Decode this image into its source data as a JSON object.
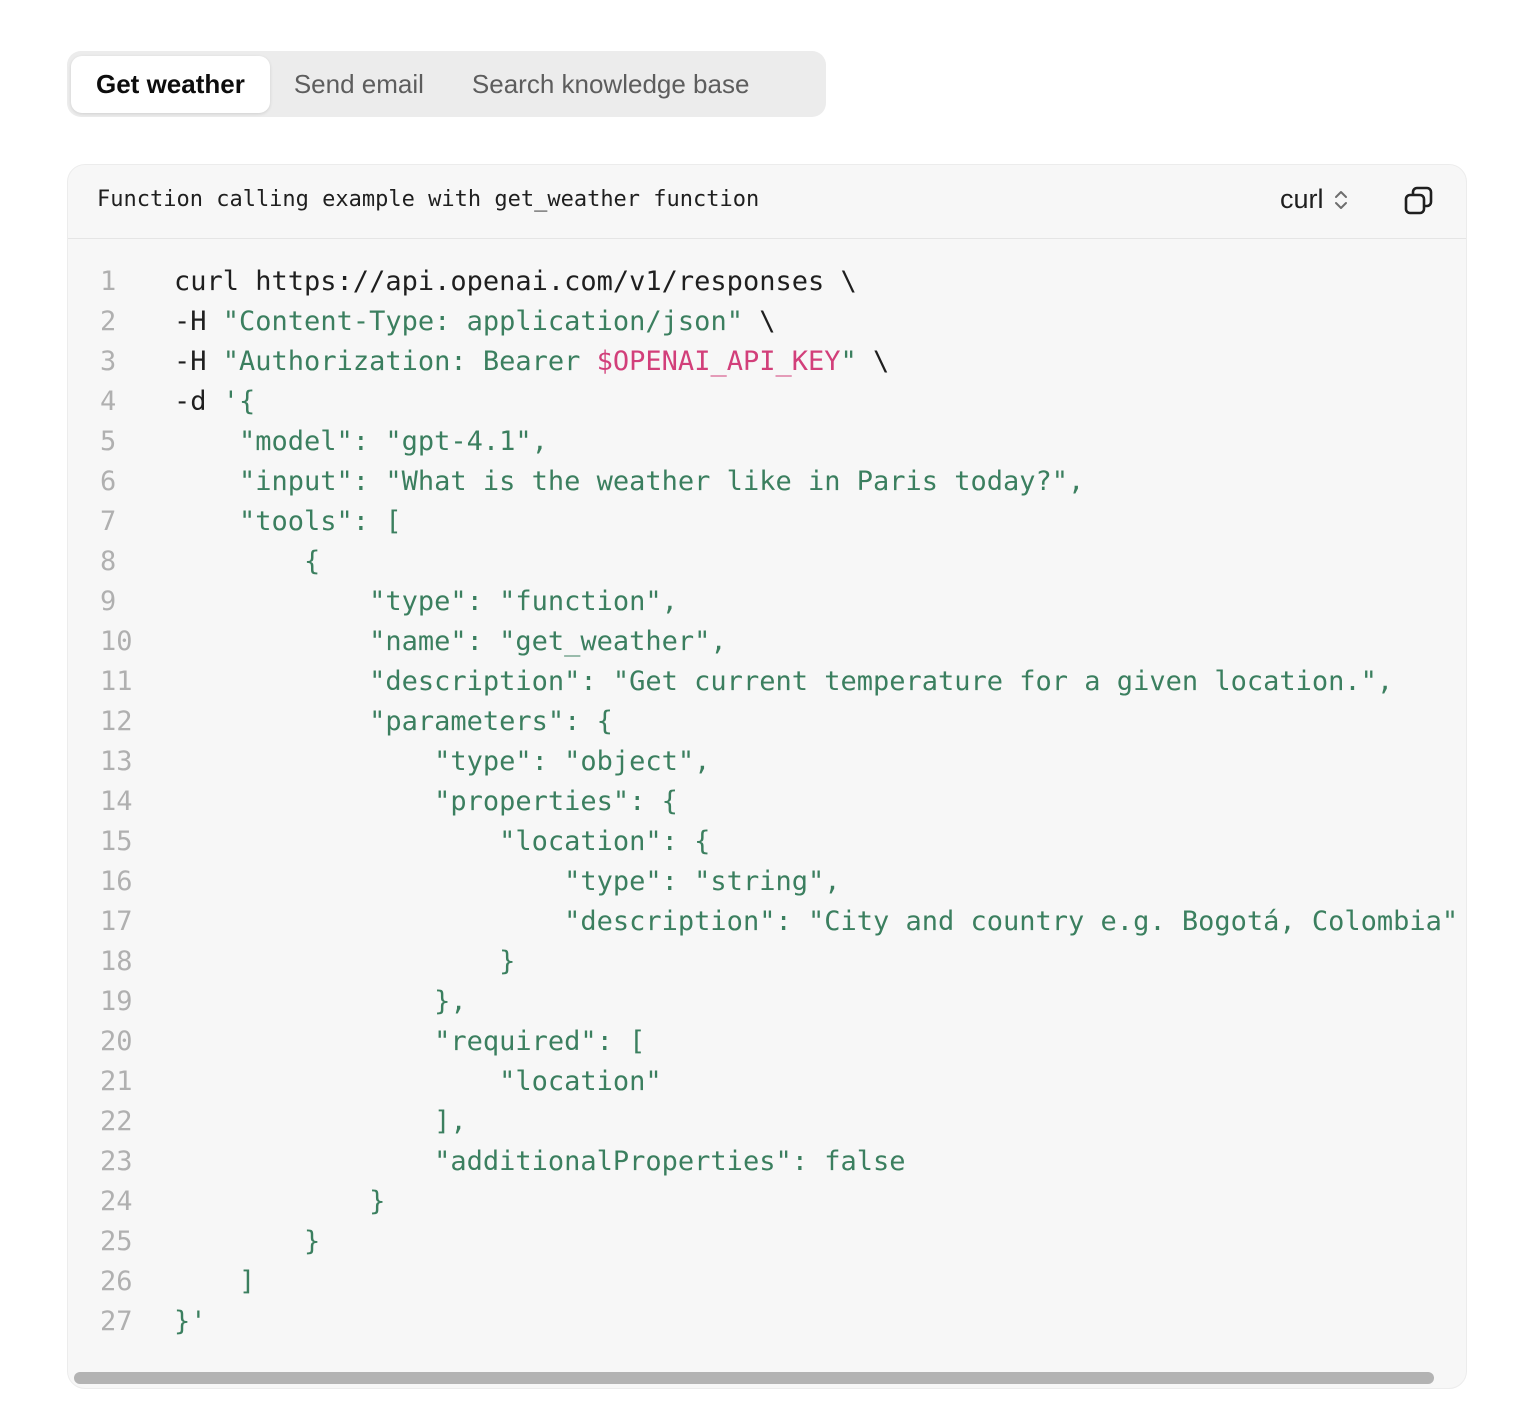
{
  "tabs": [
    {
      "label": "Get weather",
      "active": true
    },
    {
      "label": "Send email",
      "active": false
    },
    {
      "label": "Search knowledge base",
      "active": false
    }
  ],
  "code_block": {
    "title": "Function calling example with get_weather function",
    "language": "curl",
    "copy_icon": "copy-icon",
    "lines": [
      [
        {
          "t": "curl https://api.openai.com/v1/responses \\",
          "c": "plain"
        }
      ],
      [
        {
          "t": "-H ",
          "c": "plain"
        },
        {
          "t": "\"Content-Type: application/json\"",
          "c": "str"
        },
        {
          "t": " \\",
          "c": "plain"
        }
      ],
      [
        {
          "t": "-H ",
          "c": "plain"
        },
        {
          "t": "\"Authorization: Bearer ",
          "c": "str"
        },
        {
          "t": "$OPENAI_API_KEY",
          "c": "var"
        },
        {
          "t": "\"",
          "c": "str"
        },
        {
          "t": " \\",
          "c": "plain"
        }
      ],
      [
        {
          "t": "-d ",
          "c": "plain"
        },
        {
          "t": "'{",
          "c": "str"
        }
      ],
      [
        {
          "t": "    \"model\": \"gpt-4.1\",",
          "c": "str"
        }
      ],
      [
        {
          "t": "    \"input\": \"What is the weather like in Paris today?\",",
          "c": "str"
        }
      ],
      [
        {
          "t": "    \"tools\": [",
          "c": "str"
        }
      ],
      [
        {
          "t": "        {",
          "c": "str"
        }
      ],
      [
        {
          "t": "            \"type\": \"function\",",
          "c": "str"
        }
      ],
      [
        {
          "t": "            \"name\": \"get_weather\",",
          "c": "str"
        }
      ],
      [
        {
          "t": "            \"description\": \"Get current temperature for a given location.\",",
          "c": "str"
        }
      ],
      [
        {
          "t": "            \"parameters\": {",
          "c": "str"
        }
      ],
      [
        {
          "t": "                \"type\": \"object\",",
          "c": "str"
        }
      ],
      [
        {
          "t": "                \"properties\": {",
          "c": "str"
        }
      ],
      [
        {
          "t": "                    \"location\": {",
          "c": "str"
        }
      ],
      [
        {
          "t": "                        \"type\": \"string\",",
          "c": "str"
        }
      ],
      [
        {
          "t": "                        \"description\": \"City and country e.g. Bogotá, Colombia\"",
          "c": "str"
        }
      ],
      [
        {
          "t": "                    }",
          "c": "str"
        }
      ],
      [
        {
          "t": "                },",
          "c": "str"
        }
      ],
      [
        {
          "t": "                \"required\": [",
          "c": "str"
        }
      ],
      [
        {
          "t": "                    \"location\"",
          "c": "str"
        }
      ],
      [
        {
          "t": "                ],",
          "c": "str"
        }
      ],
      [
        {
          "t": "                \"additionalProperties\": false",
          "c": "str"
        }
      ],
      [
        {
          "t": "            }",
          "c": "str"
        }
      ],
      [
        {
          "t": "        }",
          "c": "str"
        }
      ],
      [
        {
          "t": "    ]",
          "c": "str"
        }
      ],
      [
        {
          "t": "}'",
          "c": "str"
        }
      ]
    ]
  },
  "colors": {
    "string": "#3b7f5f",
    "variable": "#d23f7a",
    "plain": "#1f1f1f",
    "line_number": "#b0b0b0"
  }
}
